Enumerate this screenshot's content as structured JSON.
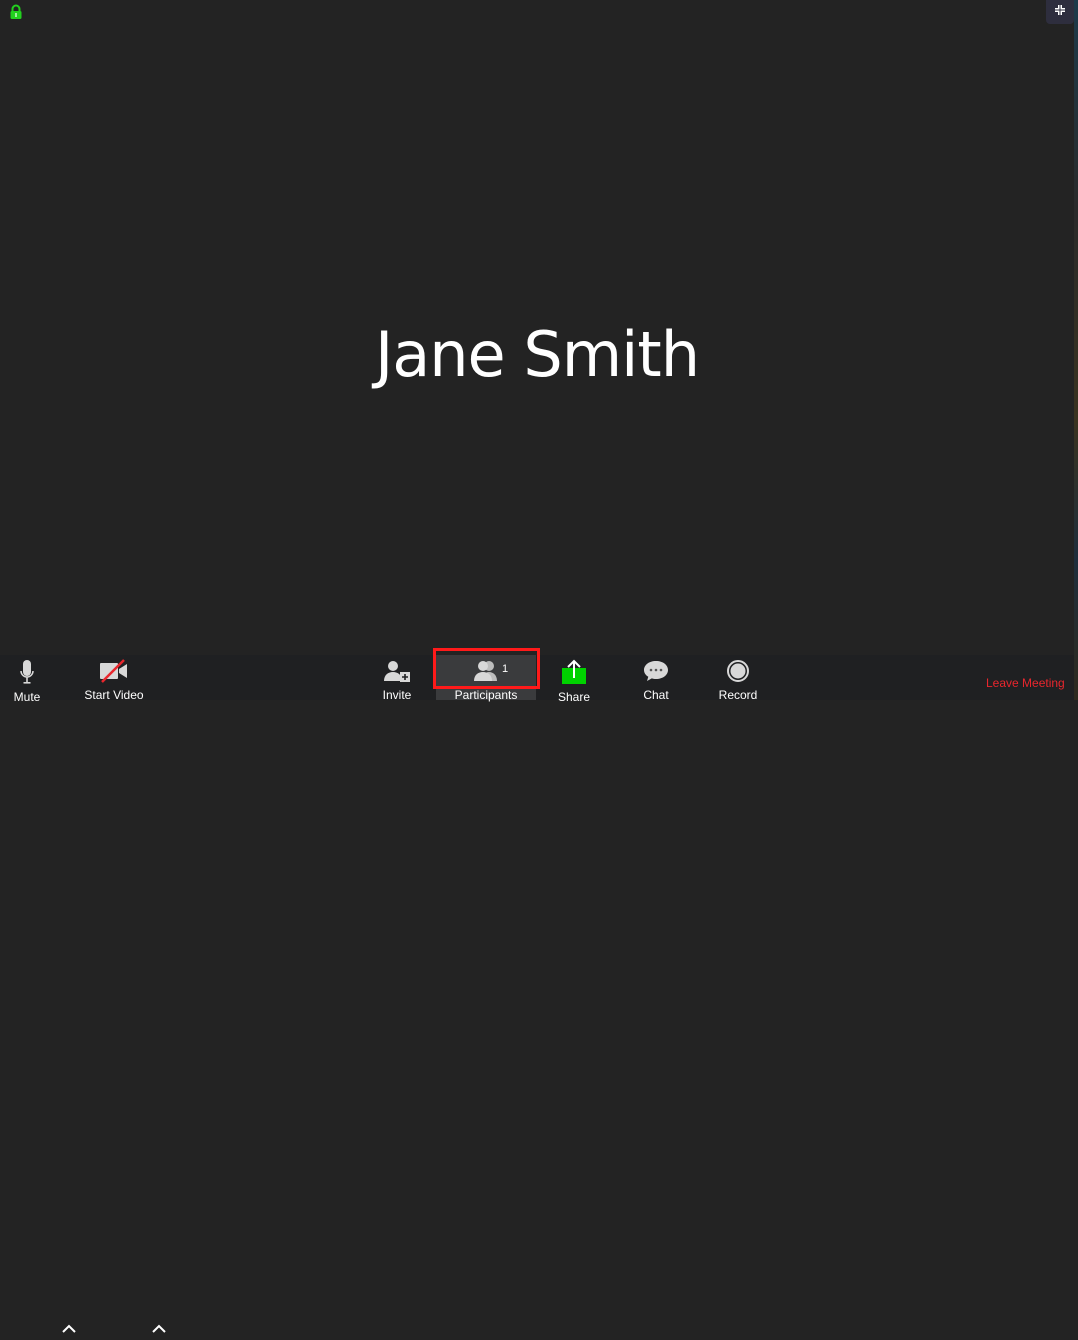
{
  "meeting": {
    "participant_name": "Jane Smith",
    "lock_icon": "lock-icon",
    "fullscreen_icon": "exit-fullscreen-icon"
  },
  "toolbar": {
    "mute": {
      "label": "Mute",
      "icon": "microphone-icon"
    },
    "video": {
      "label": "Start Video",
      "icon": "video-off-icon"
    },
    "invite": {
      "label": "Invite",
      "icon": "add-user-icon"
    },
    "participants": {
      "label": "Participants",
      "icon": "participants-icon",
      "count": "1"
    },
    "share": {
      "label": "Share",
      "icon": "share-screen-icon"
    },
    "chat": {
      "label": "Chat",
      "icon": "chat-bubble-icon"
    },
    "record": {
      "label": "Record",
      "icon": "record-icon"
    },
    "leave": {
      "label": "Leave Meeting"
    }
  },
  "colors": {
    "background": "#232323",
    "toolbar": "#1f2022",
    "accent_green": "#00d200",
    "leave_red": "#e8262d",
    "annotation_red": "#ff1a1a"
  }
}
